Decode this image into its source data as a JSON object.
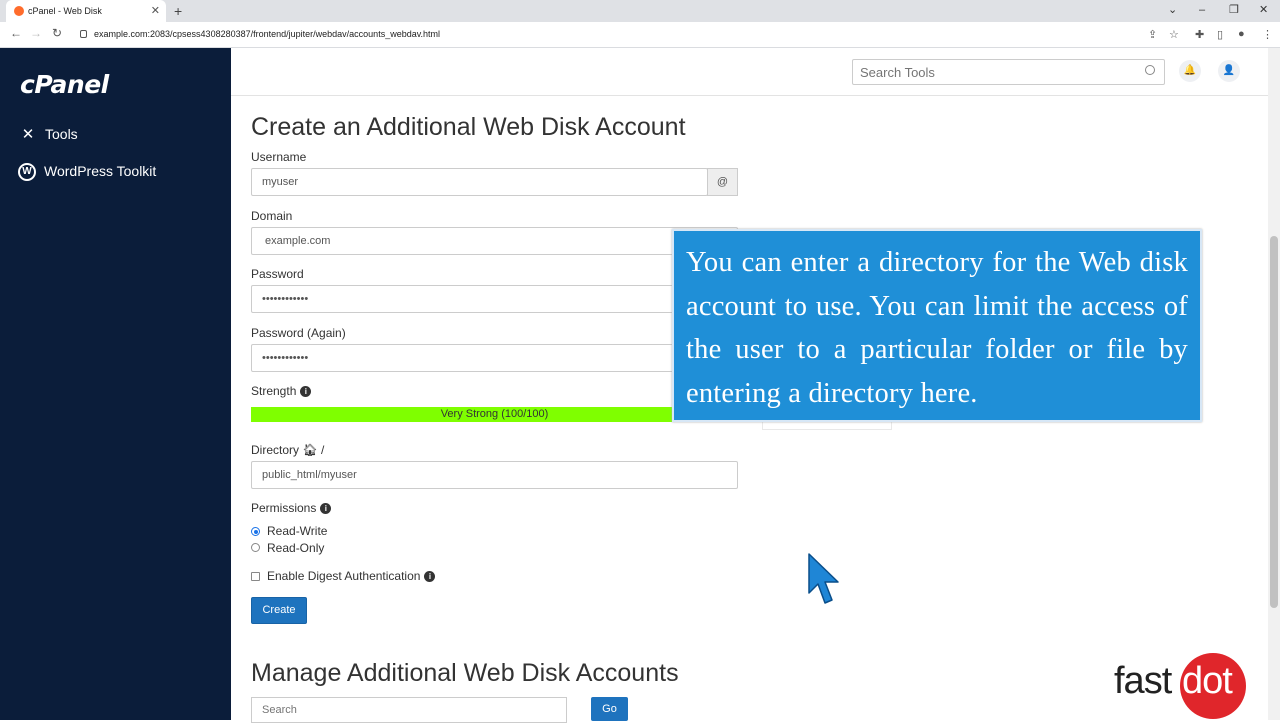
{
  "browser": {
    "tab_title": "cPanel - Web Disk",
    "url": "example.com:2083/cpsess4308280387/frontend/jupiter/webdav/accounts_webdav.html"
  },
  "sidebar": {
    "logo": "cPanel",
    "items": [
      {
        "label": "Tools",
        "icon": "tools-icon"
      },
      {
        "label": "WordPress Toolkit",
        "icon": "wordpress-icon"
      }
    ]
  },
  "header": {
    "search_placeholder": "Search Tools"
  },
  "form": {
    "title": "Create an Additional Web Disk Account",
    "username_label": "Username",
    "username_value": "myuser",
    "at_symbol": "@",
    "domain_label": "Domain",
    "domain_value": "example.com",
    "password_label": "Password",
    "password_value": "••••••••••••",
    "password_again_label": "Password (Again)",
    "password_again_value": "••••••••••••",
    "strength_label": "Strength",
    "strength_text": "Very Strong (100/100)",
    "strength_value": 100,
    "directory_label": "Directory",
    "directory_sep": "/",
    "directory_value": "public_html/myuser",
    "permissions_label": "Permissions",
    "perm_rw": "Read-Write",
    "perm_ro": "Read-Only",
    "perm_selected": "Read-Write",
    "digest_label": "Enable Digest Authentication",
    "digest_checked": false,
    "create_button": "Create"
  },
  "manage": {
    "title": "Manage Additional Web Disk Accounts",
    "search_placeholder": "Search",
    "go_button": "Go"
  },
  "overlay": {
    "callout": "You can enter a directory for the Web disk account to use. You can limit the access of the user to a particular folder or file by entering a directory here.",
    "watermark_left": "fast",
    "watermark_right": "dot"
  },
  "colors": {
    "sidebar_bg": "#0b1d3a",
    "primary_button": "#1e73be",
    "strength_bar": "#7fff00",
    "callout_bg": "#1f8fd7",
    "watermark_red": "#e0262b"
  }
}
